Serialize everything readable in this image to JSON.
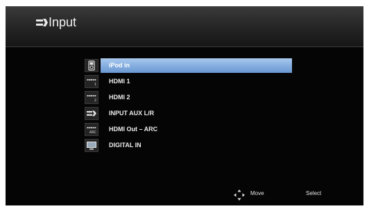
{
  "header": {
    "title": "Input",
    "icon": "input-plug-icon"
  },
  "menu": {
    "selected_index": 0,
    "selection_color": "#86afe0",
    "items": [
      {
        "label": "iPod in",
        "icon": "ipod-icon"
      },
      {
        "label": "HDMI 1",
        "icon": "hdmi-1-icon",
        "icon_text": "1"
      },
      {
        "label": "HDMI 2",
        "icon": "hdmi-2-icon",
        "icon_text": "2"
      },
      {
        "label": "INPUT AUX L/R",
        "icon": "aux-plug-icon"
      },
      {
        "label": "HDMI Out – ARC",
        "icon": "hdmi-arc-icon",
        "icon_text": "ARC"
      },
      {
        "label": "DIGITAL IN",
        "icon": "digital-in-icon"
      }
    ]
  },
  "footer": {
    "move_label": "Move",
    "select_label": "Select"
  }
}
